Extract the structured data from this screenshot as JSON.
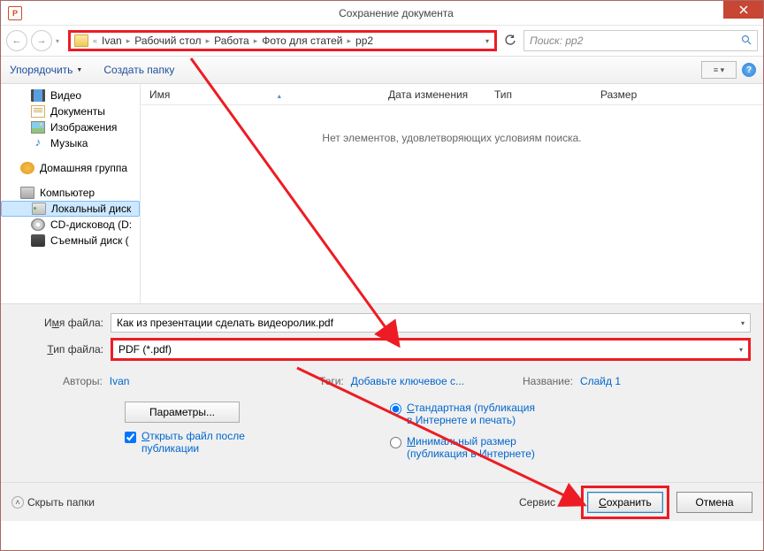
{
  "window": {
    "title": "Сохранение документа"
  },
  "breadcrumb": {
    "prefix": "«",
    "parts": [
      "Ivan",
      "Рабочий стол",
      "Работа",
      "Фото для статей",
      "pp2"
    ]
  },
  "search": {
    "placeholder": "Поиск: pp2"
  },
  "toolbar": {
    "organize": "Упорядочить",
    "newfolder": "Создать папку"
  },
  "sidebar": {
    "video": "Видео",
    "documents": "Документы",
    "images": "Изображения",
    "music": "Музыка",
    "homegroup": "Домашняя группа",
    "computer": "Компьютер",
    "localdisk": "Локальный диск",
    "cddrive": "CD-дисковод (D:",
    "removable": "Съемный диск ("
  },
  "columns": {
    "name": "Имя",
    "date": "Дата изменения",
    "type": "Тип",
    "size": "Размер"
  },
  "list": {
    "empty": "Нет элементов, удовлетворяющих условиям поиска."
  },
  "form": {
    "filename_label_pre": "И",
    "filename_label_u": "м",
    "filename_label_post": "я файла:",
    "filetype_label_pre": "",
    "filetype_label_u": "Т",
    "filetype_label_post": "ип файла:",
    "filename": "Как из презентации сделать видеоролик.pdf",
    "filetype": "PDF (*.pdf)",
    "authors_label": "Авторы:",
    "authors": "Ivan",
    "tags_label": "Теги:",
    "tags": "Добавьте ключевое с...",
    "title_label": "Название:",
    "title": "Слайд 1"
  },
  "options": {
    "params_btn_pre": "П",
    "params_btn_u": "а",
    "params_btn_post": "раметры...",
    "open_after_pre": "",
    "open_after_u": "О",
    "open_after_post": "ткрыть файл после публикации",
    "standard_pre": "",
    "standard_u": "С",
    "standard_post": "тандартная (публикация в Интернете и печать)",
    "minimal_pre": "",
    "minimal_u": "М",
    "minimal_post": "инимальный размер (публикация в Интернете)"
  },
  "footer": {
    "hide": "Скрыть папки",
    "service_pre": "С",
    "service_u": "е",
    "service_post": "рвис",
    "save_pre": "",
    "save_u": "С",
    "save_post": "охранить",
    "cancel": "Отмена"
  }
}
